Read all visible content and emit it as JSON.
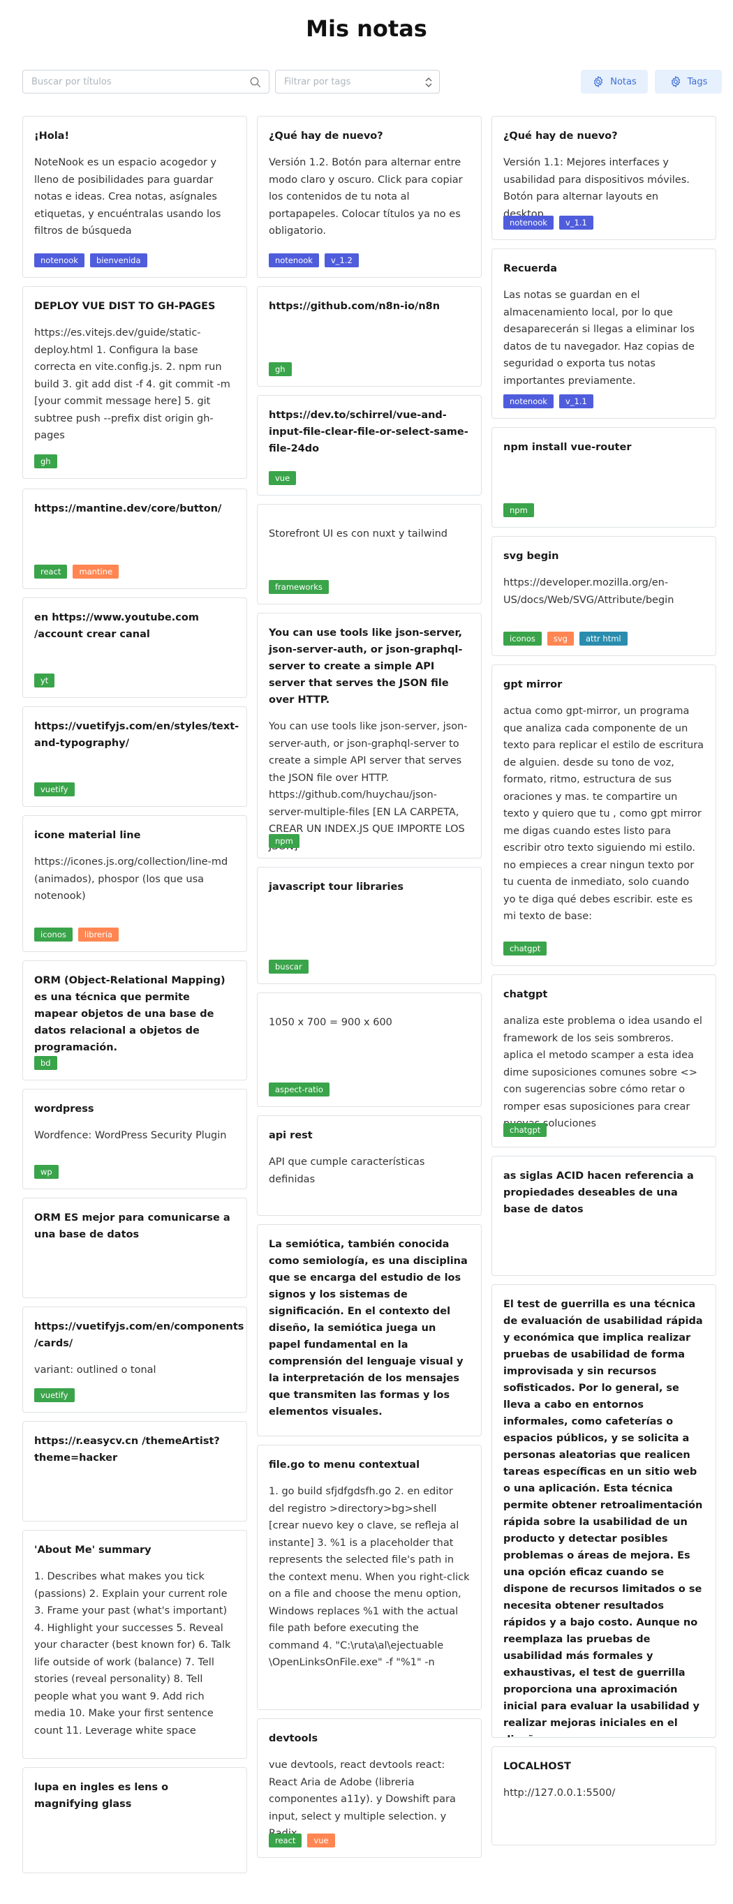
{
  "app": {
    "title": "Mis notas",
    "search_placeholder": "Buscar por títulos",
    "tag_filter_placeholder": "Filtrar por tags",
    "btn_notes": "Notas",
    "btn_tags": "Tags"
  },
  "tag_colors": {
    "blue": "#4f5ddc",
    "green": "#3aa44a",
    "orange": "#ff8652",
    "teal": "#2a8dae"
  },
  "notes": [
    {
      "title": "¡Hola!",
      "body": "NoteNook es un espacio acogedor y lleno de posibilidades para guardar notas e ideas. Crea notas, asígnales etiquetas, y encuéntralas usando los filtros de búsqueda",
      "tags": [
        {
          "label": "notenook",
          "color": "blue"
        },
        {
          "label": "bienvenida",
          "color": "blue"
        }
      ]
    },
    {
      "title": "DEPLOY VUE DIST TO GH-PAGES",
      "body": "https://es.vitejs.dev/guide/static-deploy.html 1. Configura la base correcta en vite.config.js. 2. npm run build 3. git add dist -f 4. git commit -m [your commit message here] 5. git subtree push --prefix dist origin gh-pages",
      "tags": [
        {
          "label": "gh",
          "color": "green"
        }
      ]
    },
    {
      "title": "https://mantine.dev/core/button/",
      "body": "",
      "tags": [
        {
          "label": "react",
          "color": "green"
        },
        {
          "label": "mantine",
          "color": "orange"
        }
      ]
    },
    {
      "title": "en https://www.youtube.com /account crear canal",
      "body": "",
      "tags": [
        {
          "label": "yt",
          "color": "green"
        }
      ]
    },
    {
      "title": "https://vuetifyjs.com/en/styles/text-and-typography/",
      "body": "",
      "tags": [
        {
          "label": "vuetify",
          "color": "green"
        }
      ]
    },
    {
      "title": "icone material line",
      "body": "https://icones.js.org/collection/line-md (animados), phospor (los que usa notenook)",
      "tags": [
        {
          "label": "iconos",
          "color": "green"
        },
        {
          "label": "libreria",
          "color": "orange"
        }
      ]
    },
    {
      "title": "ORM (Object-Relational Mapping) es una técnica que permite mapear objetos de una base de datos relacional a objetos de programación.",
      "body": "",
      "tags": [
        {
          "label": "bd",
          "color": "green"
        }
      ]
    },
    {
      "title": "wordpress",
      "body": "Wordfence: WordPress Security Plugin",
      "tags": [
        {
          "label": "wp",
          "color": "green"
        }
      ]
    },
    {
      "title": "ORM ES mejor para comunicarse a una base de datos",
      "body": "",
      "tags": []
    },
    {
      "title": "https://vuetifyjs.com/en/components /cards/",
      "body": "variant: outlined o tonal",
      "tags": [
        {
          "label": "vuetify",
          "color": "green"
        }
      ]
    },
    {
      "title": "https://r.easycv.cn /themeArtist?theme=hacker",
      "body": "",
      "tags": []
    },
    {
      "title": "'About Me' summary",
      "body": "1. Describes what makes you tick (passions) 2. Explain your current role 3. Frame your past (what's important) 4. Highlight your successes 5. Reveal your character (best known for) 6. Talk life outside of work (balance) 7. Tell stories (reveal personality) 8. Tell people what you want 9. Add rich media 10. Make your first sentence count 11. Leverage white space",
      "tags": []
    },
    {
      "title": "lupa en ingles es lens o magnifying glass",
      "body": "",
      "tags": []
    },
    {
      "title": "¿Qué hay de nuevo?",
      "body": "Versión 1.2. Botón para alternar entre modo claro y oscuro. Click para copiar los contenidos de tu nota al portapapeles. Colocar títulos ya no es obligatorio.",
      "tags": [
        {
          "label": "notenook",
          "color": "blue"
        },
        {
          "label": "v_1.2",
          "color": "blue"
        }
      ]
    },
    {
      "title": "https://github.com/n8n-io/n8n",
      "body": "",
      "tags": [
        {
          "label": "gh",
          "color": "green"
        }
      ]
    },
    {
      "title": "https://dev.to/schirrel/vue-and-input-file-clear-file-or-select-same-file-24do",
      "body": "",
      "tags": [
        {
          "label": "vue",
          "color": "green"
        }
      ]
    },
    {
      "title": "",
      "body": "Storefront UI es con nuxt y tailwind",
      "tags": [
        {
          "label": "frameworks",
          "color": "green"
        }
      ]
    },
    {
      "title": "You can use tools like json-server, json-server-auth, or json-graphql-server to create a simple API server that serves the JSON file over HTTP.",
      "body": "You can use tools like json-server, json-server-auth, or json-graphql-server to create a simple API server that serves the JSON file over HTTP. https://github.com/huychau/json-server-multiple-files [EN LA CARPETA, CREAR UN INDEX.JS QUE IMPORTE LOS JSON]",
      "tags": [
        {
          "label": "npm",
          "color": "green"
        }
      ]
    },
    {
      "title": "javascript tour libraries",
      "body": "",
      "tags": [
        {
          "label": "buscar",
          "color": "green"
        }
      ]
    },
    {
      "title": "",
      "body": "1050 x 700 = 900 x 600",
      "tags": [
        {
          "label": "aspect-ratio",
          "color": "green"
        }
      ]
    },
    {
      "title": "api rest",
      "body": "API que cumple características definidas",
      "tags": []
    },
    {
      "title": "La semiótica, también conocida como semiología, es una disciplina que se encarga del estudio de los signos y los sistemas de significación. En el contexto del diseño, la semiótica juega un papel fundamental en la comprensión del lenguaje visual y la interpretación de los mensajes que transmiten las formas y los elementos visuales.",
      "body": "",
      "tags": []
    },
    {
      "title": "file.go to menu contextual",
      "body": "1. go build sfjdfgdsfh.go 2. en editor del registro >directory>bg>shell [crear nuevo key o clave, se refleja al instante] 3. %1 is a placeholder that represents the selected file's path in the context menu. When you right-click on a file and choose the menu option, Windows replaces %1 with the actual file path before executing the command 4. \"C:\\ruta\\al\\ejectuable \\OpenLinksOnFile.exe\" -f \"%1\" -n",
      "tags": []
    },
    {
      "title": "devtools",
      "body": "vue devtools, react devtools react: React Aria de Adobe (libreria componentes a11y). y Dowshift para input, select y multiple selection. y Radix",
      "tags": [
        {
          "label": "react",
          "color": "green"
        },
        {
          "label": "vue",
          "color": "orange"
        }
      ]
    },
    {
      "title": "¿Qué hay de nuevo?",
      "body": "Versión 1.1: Mejores interfaces y usabilidad para dispositivos móviles. Botón para alternar layouts en desktop.",
      "tags": [
        {
          "label": "notenook",
          "color": "blue"
        },
        {
          "label": "v_1.1",
          "color": "blue"
        }
      ]
    },
    {
      "title": "Recuerda",
      "body": "Las notas se guardan en el almacenamiento local, por lo que desaparecerán si llegas a eliminar los datos de tu navegador. Haz copias de seguridad o exporta tus notas importantes previamente.",
      "tags": [
        {
          "label": "notenook",
          "color": "blue"
        },
        {
          "label": "v_1.1",
          "color": "blue"
        }
      ]
    },
    {
      "title": "npm install vue-router",
      "body": "",
      "tags": [
        {
          "label": "npm",
          "color": "green"
        }
      ]
    },
    {
      "title": "svg begin",
      "body": "https://developer.mozilla.org/en-US/docs/Web/SVG/Attribute/begin",
      "tags": [
        {
          "label": "iconos",
          "color": "green"
        },
        {
          "label": "svg",
          "color": "orange"
        },
        {
          "label": "attr html",
          "color": "teal"
        }
      ]
    },
    {
      "title": "gpt mirror",
      "body": "actua como gpt-mirror, un programa que analiza cada componente de un texto para replicar el estilo de escritura de alguien. desde su tono de voz, formato, ritmo, estructura de sus oraciones y mas. te compartire un texto y quiero que tu , como gpt mirror me digas cuando estes listo para escribir otro texto siguiendo mi estilo. no empieces a crear ningun texto por tu cuenta de inmediato, solo cuando yo te diga qué debes escribir. este es mi texto de base:",
      "tags": [
        {
          "label": "chatgpt",
          "color": "green"
        }
      ]
    },
    {
      "title": "chatgpt",
      "body": "analiza este problema o idea usando el framework de los seis sombreros. aplica el metodo scamper a esta idea dime suposiciones comunes sobre <> con sugerencias sobre cómo retar o romper esas suposiciones para crear nuevas soluciones",
      "tags": [
        {
          "label": "chatgpt",
          "color": "green"
        }
      ]
    },
    {
      "title": "as siglas ACID hacen referencia a propiedades deseables de una base de datos",
      "body": "",
      "tags": []
    },
    {
      "title": "El test de guerrilla es una técnica de evaluación de usabilidad rápida y económica que implica realizar pruebas de usabilidad de forma improvisada y sin recursos sofisticados. Por lo general, se lleva a cabo en entornos informales, como cafeterías o espacios públicos, y se solicita a personas aleatorias que realicen tareas específicas en un sitio web o una aplicación. Esta técnica permite obtener retroalimentación rápida sobre la usabilidad de un producto y detectar posibles problemas o áreas de mejora. Es una opción eficaz cuando se dispone de recursos limitados o se necesita obtener resultados rápidos y a bajo costo. Aunque no reemplaza las pruebas de usabilidad más formales y exhaustivas, el test de guerrilla proporciona una aproximación inicial para evaluar la usabilidad y realizar mejoras iniciales en el diseño.",
      "body": "",
      "tags": []
    },
    {
      "title": "LOCALHOST",
      "body": "http://127.0.0.1:5500/",
      "tags": []
    }
  ]
}
